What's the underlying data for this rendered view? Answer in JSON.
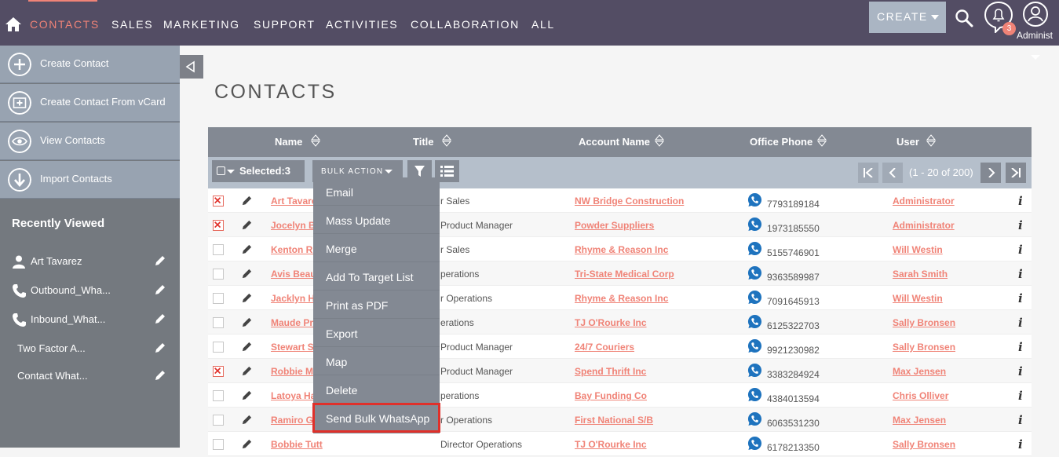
{
  "nav": {
    "active": "CONTACTS",
    "items": [
      "SALES",
      "MARKETING",
      "SUPPORT",
      "ACTIVITIES",
      "COLLABORATION",
      "ALL"
    ],
    "create": "CREATE",
    "notification_count": "3",
    "user": "Administ"
  },
  "sidebar": {
    "actions": [
      "Create Contact",
      "Create Contact From vCard",
      "View Contacts",
      "Import Contacts"
    ],
    "recent_title": "Recently Viewed",
    "recent": [
      "Art Tavarez",
      "Outbound_Wha...",
      "Inbound_What...",
      "Two Factor A...",
      "Contact What..."
    ]
  },
  "page": {
    "title": "CONTACTS"
  },
  "grid": {
    "columns": [
      "Name",
      "Title",
      "Account Name",
      "Office Phone",
      "User"
    ],
    "selected": "Selected:3",
    "bulk_action": "BULK ACTION",
    "pagination": "(1 - 20 of 200)",
    "rows": [
      {
        "name": "Art Tavare",
        "title": "r Sales",
        "account": "NW Bridge Construction",
        "phone": "7793189184",
        "user": "Administrator",
        "checked": true
      },
      {
        "name": "Jocelyn Ba",
        "title": "Product Manager",
        "account": "Powder Suppliers",
        "phone": "1973185550",
        "user": "Administrator",
        "checked": true
      },
      {
        "name": "Kenton Ro",
        "title": "r Sales",
        "account": "Rhyme & Reason Inc",
        "phone": "5155746901",
        "user": "Will Westin",
        "checked": false
      },
      {
        "name": "Avis Beauc",
        "title": "perations",
        "account": "Tri-State Medical Corp",
        "phone": "9363589987",
        "user": "Sarah Smith",
        "checked": false
      },
      {
        "name": "Jacklyn Ha",
        "title": "r Operations",
        "account": "Rhyme & Reason Inc",
        "phone": "7091645913",
        "user": "Will Westin",
        "checked": false
      },
      {
        "name": "Maude Pre",
        "title": "erations",
        "account": "TJ O'Rourke Inc",
        "phone": "6125322703",
        "user": "Sally Bronsen",
        "checked": false
      },
      {
        "name": "Stewart St",
        "title": "Product Manager",
        "account": "24/7 Couriers",
        "phone": "9921230982",
        "user": "Sally Bronsen",
        "checked": false
      },
      {
        "name": "Robbie Ma",
        "title": "Product Manager",
        "account": "Spend Thrift Inc",
        "phone": "3383284924",
        "user": "Max Jensen",
        "checked": true
      },
      {
        "name": "Latoya Ha",
        "title": "perations",
        "account": "Bay Funding Co",
        "phone": "4384013594",
        "user": "Chris Olliver",
        "checked": false
      },
      {
        "name": "Ramiro Gi",
        "title": "r Operations",
        "account": "First National S/B",
        "phone": "6063531230",
        "user": "Max Jensen",
        "checked": false
      },
      {
        "name": "Bobbie Tutt",
        "title": "Director Operations",
        "account": "TJ O'Rourke Inc",
        "phone": "6178213350",
        "user": "Sally Bronsen",
        "checked": false
      }
    ]
  },
  "bulk_menu": {
    "items": [
      "Email",
      "Mass Update",
      "Merge",
      "Add To Target List",
      "Print as PDF",
      "Export",
      "Map",
      "Delete",
      "Send Bulk WhatsApp"
    ],
    "highlighted": "Send Bulk WhatsApp"
  },
  "colors": {
    "nav_bg": "#534d64",
    "accent": "#f08377",
    "sidebar_action": "#98a3b1",
    "grid_header": "#838993",
    "highlight_border": "#e0302a",
    "whatsapp": "#1e73be"
  }
}
